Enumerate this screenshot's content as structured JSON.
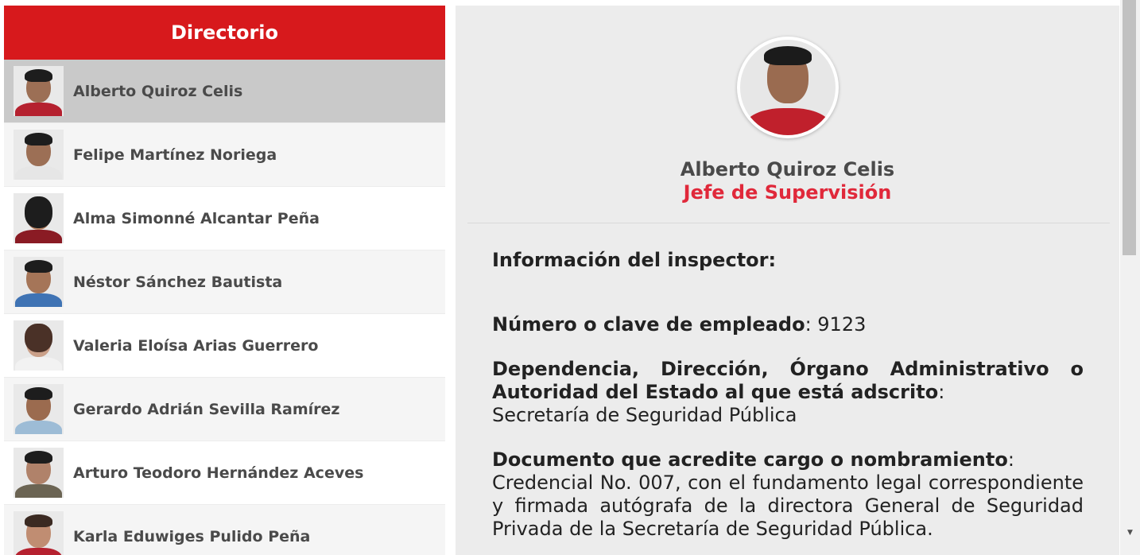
{
  "directory": {
    "title": "Directorio",
    "items": [
      {
        "name": "Alberto Quiroz Celis",
        "active": true
      },
      {
        "name": "Felipe Martínez Noriega"
      },
      {
        "name": "Alma Simonné Alcantar Peña"
      },
      {
        "name": "Néstor Sánchez Bautista"
      },
      {
        "name": "Valeria Eloísa Arias Guerrero"
      },
      {
        "name": "Gerardo Adrián Sevilla Ramírez"
      },
      {
        "name": "Arturo Teodoro Hernández Aceves"
      },
      {
        "name": "Karla Eduwiges Pulido Peña"
      }
    ]
  },
  "detail": {
    "name": "Alberto Quiroz Celis",
    "role": "Jefe de Supervisión",
    "info_title": "Información del inspector:",
    "fields": [
      {
        "label": "Número o clave de empleado",
        "value": " 9123"
      },
      {
        "label": "Dependencia, Dirección, Órgano Administrativo o Autoridad del Estado al que está adscrito",
        "value": "Secretaría de Seguridad Pública"
      },
      {
        "label": "Documento que acredite cargo o nombramiento",
        "value": "Credencial No. 007, con el fundamento legal correspondiente y firmada autógrafa de la directora General de Seguridad Privada de la Secretaría de Seguridad Pública."
      }
    ]
  },
  "colors": {
    "accent": "#d7191c",
    "role": "#e0283a",
    "active_row": "#c9c9c9"
  },
  "icons": {
    "scroll_up": "▲",
    "scroll_down": "▼"
  }
}
